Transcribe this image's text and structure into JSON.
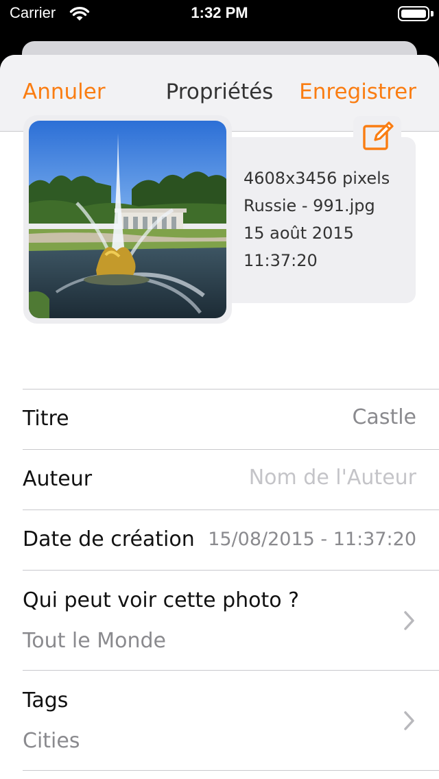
{
  "status": {
    "carrier": "Carrier",
    "time": "1:32 PM"
  },
  "nav": {
    "cancel": "Annuler",
    "title": "Propriétés",
    "save": "Enregistrer",
    "accent": "#fa7d12"
  },
  "photo": {
    "dimensions": "4608x3456 pixels",
    "filename": "Russie - 991.jpg",
    "date": "15 août 2015",
    "time": "11:37:20",
    "edit_icon": "edit-square-icon"
  },
  "form": {
    "title_label": "Titre",
    "title_value": "Castle",
    "author_label": "Auteur",
    "author_placeholder": "Nom de l'Auteur",
    "created_label": "Date de création",
    "created_value": "15/08/2015 - 11:37:20",
    "privacy_label": "Qui peut voir cette photo ?",
    "privacy_value": "Tout le Monde",
    "tags_label": "Tags",
    "tags_value": "Cities"
  }
}
